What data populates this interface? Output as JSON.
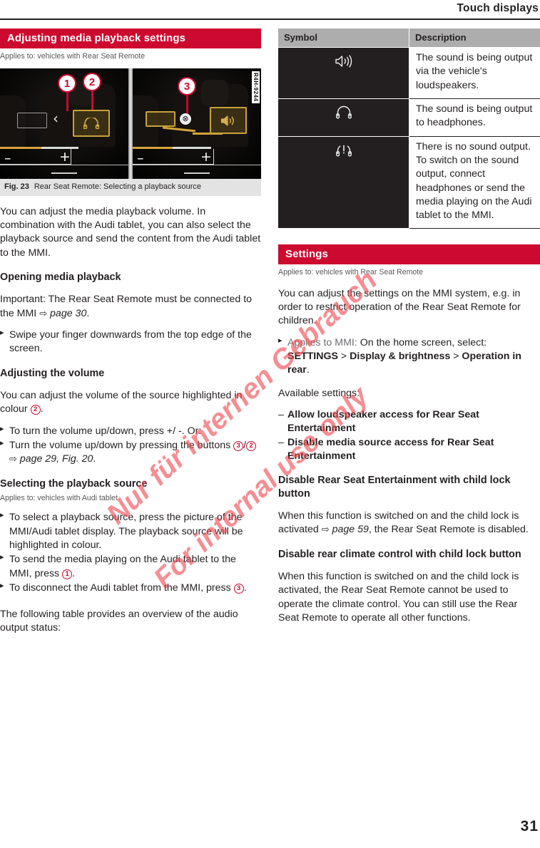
{
  "header": {
    "title": "Touch displays"
  },
  "page_number": "31",
  "watermark": {
    "line1": "Nur für internen Gebrauch",
    "line2": "For internal use only",
    "color": "#ef4a52"
  },
  "colors": {
    "accent_red": "#cc0a2f",
    "table_header_gray": "#adadad",
    "symbol_cell_dark": "#231f20",
    "caption_gray": "#e3e3e3",
    "highlight_gold": "#c8a23a"
  },
  "left_column": {
    "section": {
      "title": "Adjusting media playback settings",
      "applies_to": "Applies to: vehicles with Rear Seat Remote"
    },
    "figure": {
      "caption_number": "Fig. 23",
      "caption_text": "Rear Seat Remote: Selecting a playback source",
      "image_code": "R4H-9244",
      "callouts": [
        "1",
        "2",
        "3"
      ],
      "left_panel": {
        "chevron": "‹",
        "highlight_icon": "headphones-icon",
        "volume_minus": "–",
        "volume_plus": "+"
      },
      "right_panel": {
        "close_marker": "⊗",
        "highlight_icon": "speaker-icon",
        "volume_minus": "–",
        "volume_plus": "+"
      }
    },
    "intro": "You can adjust the media playback volume. In combination with the Audi tablet, you can also select the playback source and send the content from the Audi tablet to the MMI.",
    "opening": {
      "heading": "Opening media playback",
      "important_pre": "Important: The Rear Seat Remote must be connected to the MMI ",
      "important_ref": "page 30",
      "important_post": ".",
      "bullet1": "Swipe your finger downwards from the top edge of the screen."
    },
    "volume": {
      "heading": "Adjusting the volume",
      "body_pre": "You can adjust the volume of the source highlighted in colour ",
      "body_num": "2",
      "body_post": ".",
      "bullet1": "To turn the volume up/down, press +/ -. Or:",
      "bullet2_pre": "Turn the volume up/down by pressing the buttons ",
      "bullet2_num_a": "3",
      "bullet2_num_b": "2",
      "bullet2_ref": "page 29, Fig. 20",
      "bullet2_post": "."
    },
    "selecting": {
      "heading": "Selecting the playback source",
      "applies_to": "Applies to: vehicles with Audi tablet",
      "bullet1": "To select a playback source, press the picture of the MMI/Audi tablet display. The playback source will be highlighted in colour.",
      "bullet2_pre": "To send the media playing on the Audi tablet to the MMI, press ",
      "bullet2_num": "1",
      "bullet2_post": ".",
      "bullet3_pre": "To disconnect the Audi tablet from the MMI, press ",
      "bullet3_num": "3",
      "bullet3_post": "."
    },
    "closing": "The following table provides an overview of the audio output status:"
  },
  "right_column": {
    "table": {
      "headers": [
        "Symbol",
        "Description"
      ],
      "rows": [
        {
          "symbol_name": "speaker-icon",
          "description": "The sound is being output via the vehicle's loudspeakers."
        },
        {
          "symbol_name": "headphones-icon",
          "description": "The sound is being output to headphones."
        },
        {
          "symbol_name": "headphones-muted-icon",
          "description": "There is no sound output. To switch on the sound output, connect headphones or send the media playing on the Audi tablet to the MMI."
        }
      ]
    },
    "settings": {
      "title": "Settings",
      "applies_to": "Applies to: vehicles with Rear Seat Remote",
      "intro": "You can adjust the settings on the MMI system, e.g. in order to restrict operation of the Rear Seat Remote for children.",
      "bullet_label": "Applies to MMI:",
      "bullet_text": " On the home screen, select: ",
      "path_1": "SETTINGS",
      "path_sep_1": " > ",
      "path_2": "Display & brightness",
      "path_sep_2": " > ",
      "path_3": "Operation in rear",
      "path_end": ".",
      "available_label": "Available settings:",
      "options": [
        "Allow loudspeaker access for Rear Seat Entertainment",
        "Disable media source access for Rear Seat Entertainment"
      ],
      "disable_rse": {
        "heading": "Disable Rear Seat Entertainment with child lock button",
        "body_pre": "When this function is switched on and the child lock is activated ",
        "body_ref": "page 59",
        "body_post": ", the Rear Seat Remote is disabled."
      },
      "disable_climate": {
        "heading": "Disable rear climate control with child lock button",
        "body": "When this function is switched on and the child lock is activated, the Rear Seat Remote cannot be used to operate the climate control. You can still use the Rear Seat Remote to operate all other functions."
      }
    }
  }
}
